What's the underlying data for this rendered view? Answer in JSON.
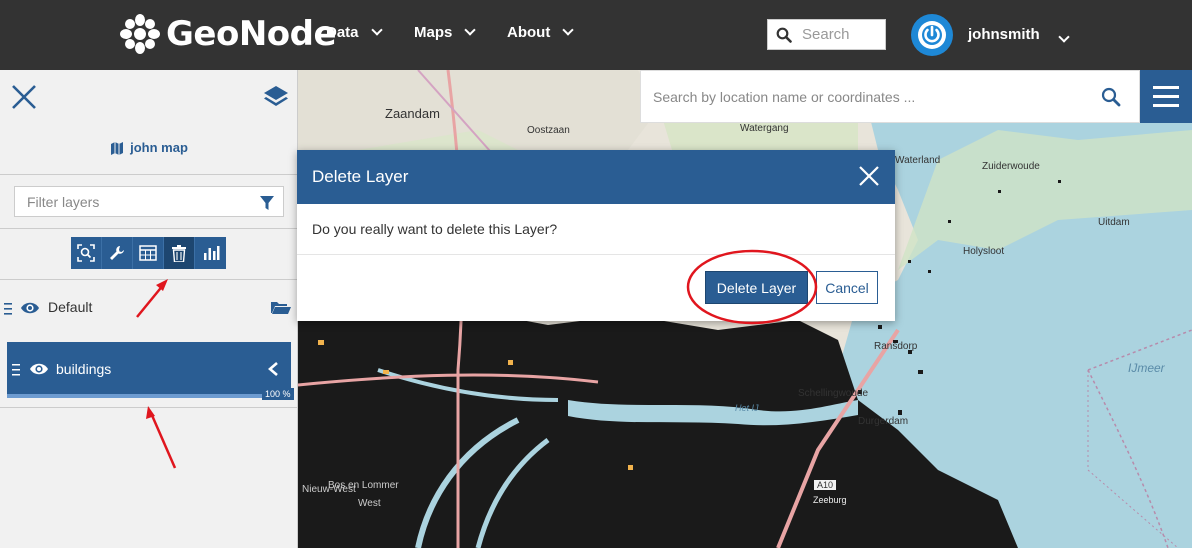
{
  "nav": {
    "brand": "GeoNode",
    "items": [
      {
        "label": "Data"
      },
      {
        "label": "Maps"
      },
      {
        "label": "About"
      }
    ],
    "search_placeholder": "Search",
    "username": "johnsmith"
  },
  "map": {
    "search_placeholder": "Search by location name or coordinates ...",
    "labels": [
      "Zaandam",
      "Oostzaan",
      "Watergang",
      "Waterland",
      "Zuiderwoude",
      "Uitdam",
      "Holysloot",
      "Ransdorp",
      "Schellingwoude",
      "Durgerdam",
      "IJmeer",
      "Het IJ",
      "A10",
      "Zeeburg",
      "Bos en Lommer",
      "West",
      "Nieuw-West"
    ]
  },
  "panel": {
    "map_title": "john map",
    "filter_placeholder": "Filter layers",
    "group_name": "Default",
    "layer_name": "buildings",
    "opacity_label": "100 %",
    "opacity": 1.0
  },
  "modal": {
    "title": "Delete Layer",
    "message": "Do you really want to delete this Layer?",
    "confirm_label": "Delete Layer",
    "cancel_label": "Cancel"
  },
  "colors": {
    "nav_bg": "#333333",
    "primary": "#2a5d93",
    "annotation": "#e0161e"
  }
}
